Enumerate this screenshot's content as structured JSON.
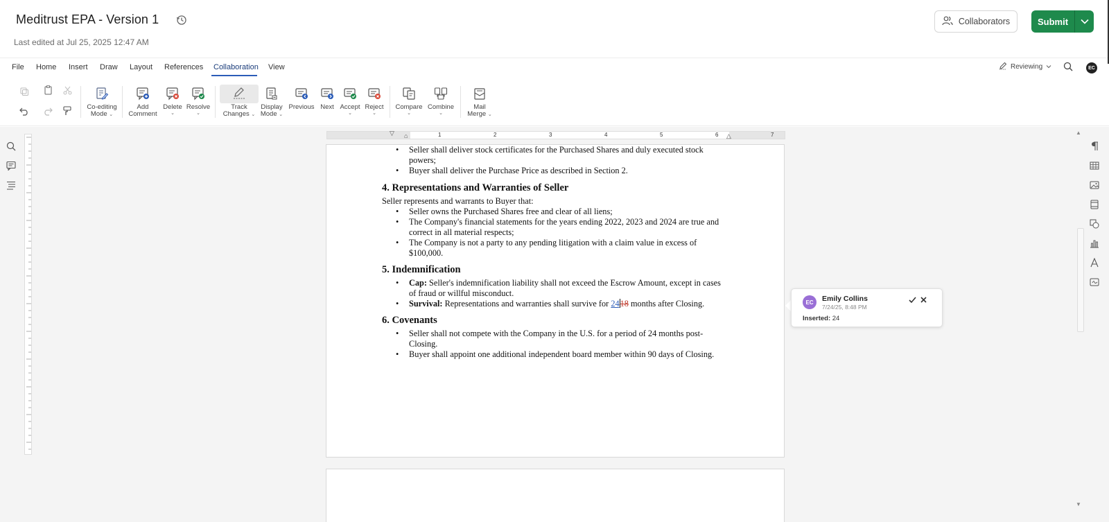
{
  "header": {
    "title": "Meditrust EPA - Version 1",
    "last_edited": "Last edited at Jul 25, 2025 12:47 AM",
    "collaborators_label": "Collaborators",
    "submit_label": "Submit"
  },
  "menu": {
    "items": [
      "File",
      "Home",
      "Insert",
      "Draw",
      "Layout",
      "References",
      "Collaboration",
      "View"
    ],
    "active": "Collaboration",
    "mode_label": "Reviewing",
    "user_initials": "EC"
  },
  "ribbon": {
    "coediting": "Co-editing Mode",
    "coediting_l1": "Co-editing",
    "coediting_l2": "Mode",
    "add_comment_l1": "Add",
    "add_comment_l2": "Comment",
    "delete": "Delete",
    "resolve": "Resolve",
    "track_l1": "Track",
    "track_l2": "Changes",
    "display_l1": "Display",
    "display_l2": "Mode",
    "previous": "Previous",
    "next": "Next",
    "accept": "Accept",
    "reject": "Reject",
    "compare": "Compare",
    "combine": "Combine",
    "mail_l1": "Mail",
    "mail_l2": "Merge"
  },
  "ruler": {
    "numbers": [
      "1",
      "2",
      "3",
      "4",
      "5",
      "6",
      "7"
    ]
  },
  "document": {
    "bullets_top": [
      "Seller shall deliver stock certificates for the Purchased Shares and duly executed stock powers;",
      "Buyer shall deliver the Purchase Price as described in Section 2."
    ],
    "sec4": {
      "heading": "4. Representations and Warranties of Seller",
      "intro": "Seller represents and warrants to Buyer that:",
      "items": [
        "Seller owns the Purchased Shares free and clear of all liens;",
        "The Company's financial statements for the years ending 2022, 2023 and 2024 are true and correct in all material respects;",
        "The Company is not a party to any pending litigation with a claim value in excess of $100,000."
      ]
    },
    "sec5": {
      "heading": "5. Indemnification",
      "cap_label": "Cap:",
      "cap_text": " Seller's indemnification liability shall not exceed the Escrow Amount, except in cases of fraud or willful misconduct.",
      "survival_label": "Survival:",
      "survival_before": " Representations and warranties shall survive for ",
      "survival_inserted": "24",
      "survival_deleted": "18",
      "survival_after": " months after Closing."
    },
    "sec6": {
      "heading": "6. Covenants",
      "items": [
        "Seller shall not compete with the Company in the U.S. for a period of 24 months post-Closing.",
        "Buyer shall appoint one additional independent board member within 90 days of Closing."
      ]
    }
  },
  "comment": {
    "initials": "EC",
    "author": "Emily Collins",
    "time": "7/24/25, 8:48 PM",
    "change_label": "Inserted:",
    "change_value": "24",
    "avatar_color": "#9a6fd6"
  },
  "colors": {
    "accent_green": "#1e8a4c",
    "tab_underline": "#2b5cb8",
    "insert_color": "#2b5cb8",
    "delete_color": "#c0392b"
  }
}
